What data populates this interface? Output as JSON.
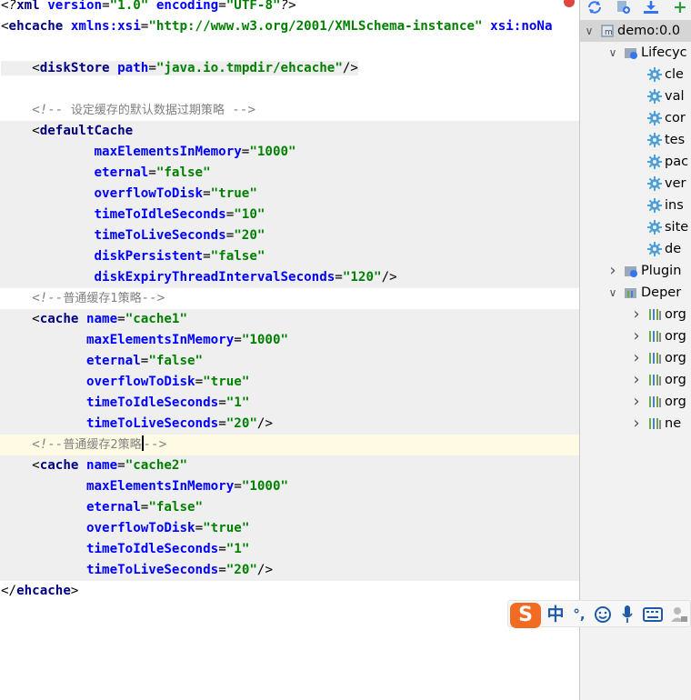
{
  "editor": {
    "lines": [
      [
        {
          "c": "pi",
          "t": "<?"
        },
        {
          "c": "tag",
          "t": "xml "
        },
        {
          "c": "attr",
          "t": "version"
        },
        {
          "c": "pun",
          "t": "="
        },
        {
          "c": "val",
          "t": "\"1.0\" "
        },
        {
          "c": "attr",
          "t": "encoding"
        },
        {
          "c": "pun",
          "t": "="
        },
        {
          "c": "val",
          "t": "\"UTF-8\""
        },
        {
          "c": "pi",
          "t": "?>"
        }
      ],
      [
        {
          "c": "pun",
          "t": "<"
        },
        {
          "c": "tag",
          "t": "ehcache "
        },
        {
          "c": "attr",
          "t": "xmlns:xsi"
        },
        {
          "c": "pun",
          "t": "="
        },
        {
          "c": "val",
          "t": "\"http://www.w3.org/2001/XMLSchema-instance\" "
        },
        {
          "c": "attr",
          "t": "xsi:noNa"
        }
      ],
      [],
      [
        {
          "c": "sub",
          "t": "    "
        },
        {
          "c": "pun sub",
          "t": "<"
        },
        {
          "c": "tag sub",
          "t": "diskStore "
        },
        {
          "c": "attr sub",
          "t": "path"
        },
        {
          "c": "pun sub",
          "t": "="
        },
        {
          "c": "val sub",
          "t": "\"java.io.tmpdir/ehcache\""
        },
        {
          "c": "pun sub",
          "t": "/>"
        }
      ],
      [],
      [
        {
          "c": "pun",
          "t": "    "
        },
        {
          "c": "com",
          "t": "<!-- "
        },
        {
          "c": "comcn",
          "t": "设定缓存的默认数据过期策略"
        },
        {
          "c": "com",
          "t": " -->"
        }
      ],
      [
        {
          "c": "pun",
          "t": "    <"
        },
        {
          "c": "tag",
          "t": "defaultCache"
        }
      ],
      [
        {
          "c": "pun",
          "t": "            "
        },
        {
          "c": "attr",
          "t": "maxElementsInMemory"
        },
        {
          "c": "pun",
          "t": "="
        },
        {
          "c": "val",
          "t": "\"1000\""
        }
      ],
      [
        {
          "c": "pun",
          "t": "            "
        },
        {
          "c": "attr",
          "t": "eternal"
        },
        {
          "c": "pun",
          "t": "="
        },
        {
          "c": "val",
          "t": "\"false\""
        }
      ],
      [
        {
          "c": "pun",
          "t": "            "
        },
        {
          "c": "attr",
          "t": "overflowToDisk"
        },
        {
          "c": "pun",
          "t": "="
        },
        {
          "c": "val",
          "t": "\"true\""
        }
      ],
      [
        {
          "c": "pun",
          "t": "            "
        },
        {
          "c": "attr",
          "t": "timeToIdleSeconds"
        },
        {
          "c": "pun",
          "t": "="
        },
        {
          "c": "val",
          "t": "\"10\""
        }
      ],
      [
        {
          "c": "pun",
          "t": "            "
        },
        {
          "c": "attr",
          "t": "timeToLiveSeconds"
        },
        {
          "c": "pun",
          "t": "="
        },
        {
          "c": "val",
          "t": "\"20\""
        }
      ],
      [
        {
          "c": "pun",
          "t": "            "
        },
        {
          "c": "attr",
          "t": "diskPersistent"
        },
        {
          "c": "pun",
          "t": "="
        },
        {
          "c": "val",
          "t": "\"false\""
        }
      ],
      [
        {
          "c": "pun",
          "t": "            "
        },
        {
          "c": "attr",
          "t": "diskExpiryThreadIntervalSeconds"
        },
        {
          "c": "pun",
          "t": "="
        },
        {
          "c": "val",
          "t": "\"120\""
        },
        {
          "c": "pun",
          "t": "/>"
        }
      ],
      [
        {
          "c": "pun",
          "t": "    "
        },
        {
          "c": "com",
          "t": "<!--"
        },
        {
          "c": "comcn",
          "t": "普通缓存1策略"
        },
        {
          "c": "com",
          "t": "-->"
        }
      ],
      [
        {
          "c": "pun",
          "t": "    <"
        },
        {
          "c": "tag",
          "t": "cache "
        },
        {
          "c": "attr",
          "t": "name"
        },
        {
          "c": "pun",
          "t": "="
        },
        {
          "c": "val",
          "t": "\"cache1\""
        }
      ],
      [
        {
          "c": "pun",
          "t": "           "
        },
        {
          "c": "attr",
          "t": "maxElementsInMemory"
        },
        {
          "c": "pun",
          "t": "="
        },
        {
          "c": "val",
          "t": "\"1000\""
        }
      ],
      [
        {
          "c": "pun",
          "t": "           "
        },
        {
          "c": "attr",
          "t": "eternal"
        },
        {
          "c": "pun",
          "t": "="
        },
        {
          "c": "val",
          "t": "\"false\""
        }
      ],
      [
        {
          "c": "pun",
          "t": "           "
        },
        {
          "c": "attr",
          "t": "overflowToDisk"
        },
        {
          "c": "pun",
          "t": "="
        },
        {
          "c": "val",
          "t": "\"true\""
        }
      ],
      [
        {
          "c": "pun",
          "t": "           "
        },
        {
          "c": "attr",
          "t": "timeToIdleSeconds"
        },
        {
          "c": "pun",
          "t": "="
        },
        {
          "c": "val",
          "t": "\"1\""
        }
      ],
      [
        {
          "c": "pun",
          "t": "           "
        },
        {
          "c": "attr",
          "t": "timeToLiveSeconds"
        },
        {
          "c": "pun",
          "t": "="
        },
        {
          "c": "val",
          "t": "\"20\""
        },
        {
          "c": "pun",
          "t": "/>"
        }
      ],
      [
        {
          "c": "pun",
          "t": "    "
        },
        {
          "c": "com",
          "t": "<!--"
        },
        {
          "c": "comcn",
          "t": "普通缓存2策略"
        },
        {
          "c": "caret",
          "t": ""
        },
        {
          "c": "com",
          "t": "-->"
        }
      ],
      [
        {
          "c": "pun",
          "t": "    <"
        },
        {
          "c": "tag",
          "t": "cache "
        },
        {
          "c": "attr",
          "t": "name"
        },
        {
          "c": "pun",
          "t": "="
        },
        {
          "c": "val",
          "t": "\"cache2\""
        }
      ],
      [
        {
          "c": "pun",
          "t": "           "
        },
        {
          "c": "attr",
          "t": "maxElementsInMemory"
        },
        {
          "c": "pun",
          "t": "="
        },
        {
          "c": "val",
          "t": "\"1000\""
        }
      ],
      [
        {
          "c": "pun",
          "t": "           "
        },
        {
          "c": "attr",
          "t": "eternal"
        },
        {
          "c": "pun",
          "t": "="
        },
        {
          "c": "val",
          "t": "\"false\""
        }
      ],
      [
        {
          "c": "pun",
          "t": "           "
        },
        {
          "c": "attr",
          "t": "overflowToDisk"
        },
        {
          "c": "pun",
          "t": "="
        },
        {
          "c": "val",
          "t": "\"true\""
        }
      ],
      [
        {
          "c": "pun",
          "t": "           "
        },
        {
          "c": "attr",
          "t": "timeToIdleSeconds"
        },
        {
          "c": "pun",
          "t": "="
        },
        {
          "c": "val",
          "t": "\"1\""
        }
      ],
      [
        {
          "c": "pun",
          "t": "           "
        },
        {
          "c": "attr",
          "t": "timeToLiveSeconds"
        },
        {
          "c": "pun",
          "t": "="
        },
        {
          "c": "val",
          "t": "\"20\""
        },
        {
          "c": "pun",
          "t": "/>"
        }
      ],
      [
        {
          "c": "pun",
          "t": "</"
        },
        {
          "c": "tag",
          "t": "ehcache"
        },
        {
          "c": "pun",
          "t": ">"
        }
      ]
    ],
    "shaded_lines": [
      6,
      7,
      8,
      9,
      10,
      11,
      12,
      13,
      15,
      16,
      17,
      18,
      19,
      20,
      22,
      23,
      24,
      25,
      26,
      27
    ],
    "caret_line": 21
  },
  "maven": {
    "toolbar_icons": [
      "refresh-icon",
      "generate-sources-icon",
      "download-icon",
      "add-icon"
    ],
    "tree": [
      {
        "label": "demo:0.0",
        "icon": "maven-module-icon",
        "chevron": "expanded",
        "indent": 0,
        "selected": true
      },
      {
        "label": "Lifecyc",
        "icon": "lifecycle-folder-icon",
        "chevron": "expanded",
        "indent": 1
      },
      {
        "label": "cle",
        "icon": "gear-icon",
        "indent": 2
      },
      {
        "label": "val",
        "icon": "gear-icon",
        "indent": 2
      },
      {
        "label": "cor",
        "icon": "gear-icon",
        "indent": 2
      },
      {
        "label": "tes",
        "icon": "gear-icon",
        "indent": 2
      },
      {
        "label": "pac",
        "icon": "gear-icon",
        "indent": 2
      },
      {
        "label": "ver",
        "icon": "gear-icon",
        "indent": 2
      },
      {
        "label": "ins",
        "icon": "gear-icon",
        "indent": 2
      },
      {
        "label": "site",
        "icon": "gear-icon",
        "indent": 2
      },
      {
        "label": "de",
        "icon": "gear-icon",
        "indent": 2
      },
      {
        "label": "Plugin",
        "icon": "plugins-folder-icon",
        "chevron": "collapsed",
        "indent": 1
      },
      {
        "label": "Deper",
        "icon": "dependencies-folder-icon",
        "chevron": "expanded",
        "indent": 1
      },
      {
        "label": "org",
        "icon": "library-icon",
        "chevron": "collapsed",
        "indent": 2
      },
      {
        "label": "org",
        "icon": "library-icon",
        "chevron": "collapsed",
        "indent": 2
      },
      {
        "label": "org",
        "icon": "library-icon",
        "chevron": "collapsed",
        "indent": 2
      },
      {
        "label": "org",
        "icon": "library-icon",
        "chevron": "collapsed",
        "indent": 2
      },
      {
        "label": "org",
        "icon": "library-icon",
        "chevron": "collapsed",
        "indent": 2
      },
      {
        "label": "ne",
        "icon": "library-icon",
        "chevron": "collapsed",
        "indent": 2
      }
    ]
  },
  "ime": {
    "logo": "S",
    "mode": "中",
    "punct": "°,"
  },
  "colors": {
    "tag": "#000080",
    "attribute": "#0000ff",
    "value": "#008000",
    "comment": "#808080",
    "shade": "#efefef",
    "caret_line": "#fffae3",
    "ime_brand": "#f26b22"
  }
}
